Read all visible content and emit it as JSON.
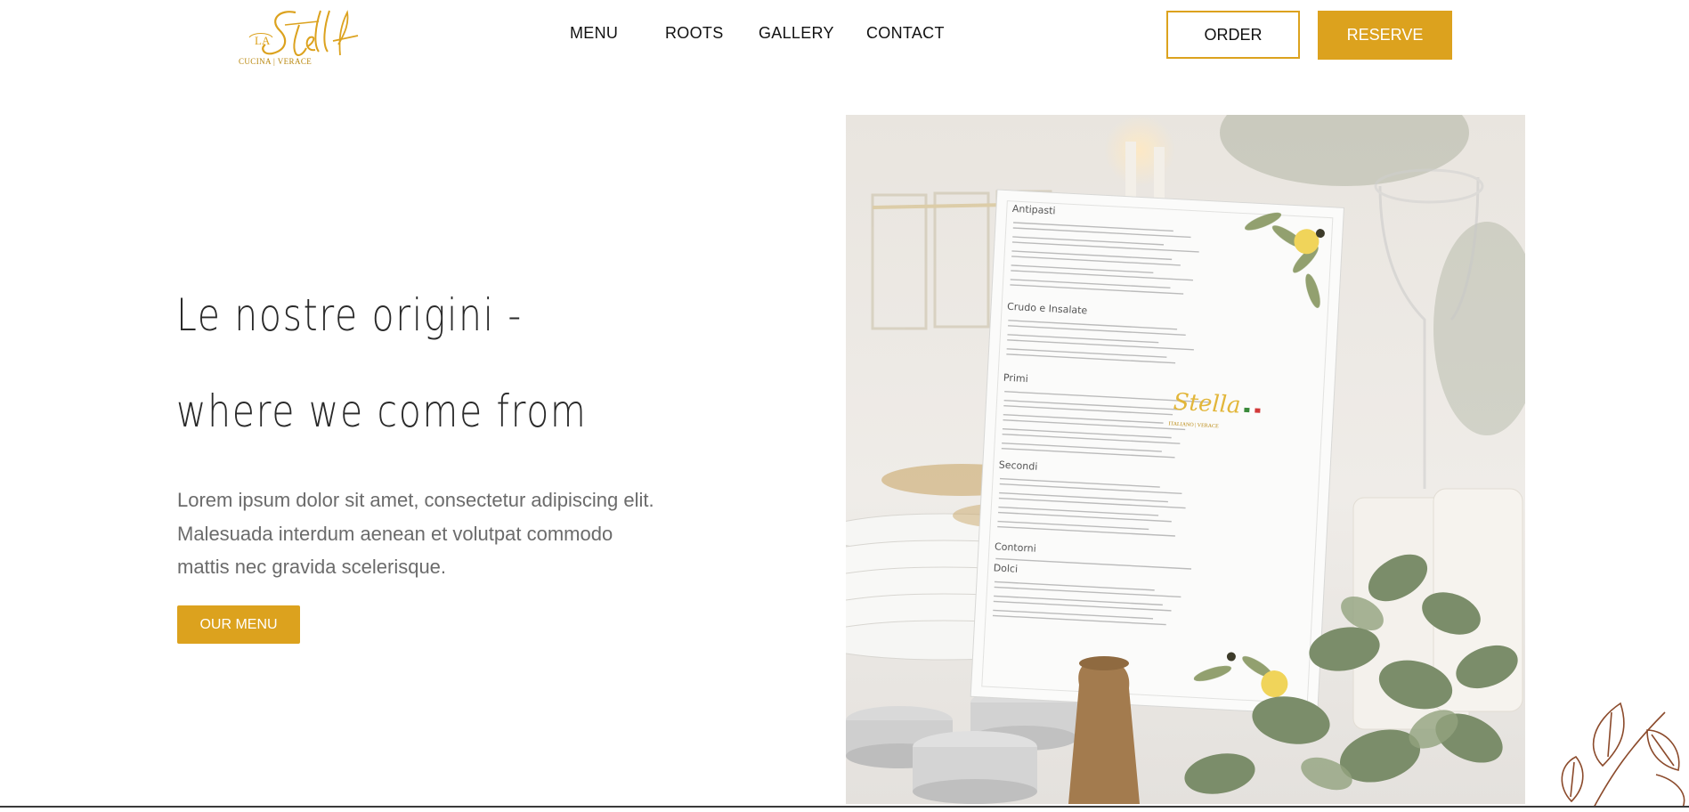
{
  "header": {
    "logo": {
      "wordmark": "Stella",
      "prefix": "LA",
      "tagline": "CUCINA | VERACE"
    },
    "nav": [
      {
        "label": "MENU"
      },
      {
        "label": "ROOTS"
      },
      {
        "label": "GALLERY"
      },
      {
        "label": "CONTACT"
      }
    ],
    "order_label": "ORDER",
    "reserve_label": "RESERVE"
  },
  "hero": {
    "headline_line1": "Le nostre origini -",
    "headline_line2": "where we come from",
    "paragraph": "Lorem ipsum dolor sit amet, consectetur adipiscing elit. Malesuada interdum aenean et volutpat commodo mattis nec gravida scelerisque.",
    "cta_label": "OUR MENU"
  },
  "photo": {
    "menu_card": {
      "sections": [
        "Antipasti",
        "Crudo e Insalate",
        "Primi",
        "Secondi",
        "Contorni",
        "Dolci"
      ],
      "logo_wordmark": "Stella",
      "logo_tagline": "ITALIANO | VERACE"
    }
  },
  "colors": {
    "accent": "#dca21e",
    "text_dark": "#2a2a2a",
    "text_muted": "#6b6b6b",
    "decor_brown": "#8b4a2b"
  }
}
